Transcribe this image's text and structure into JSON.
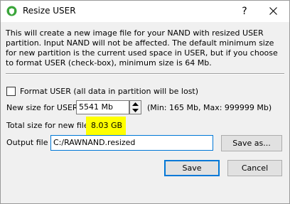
{
  "window": {
    "title": "Resize USER",
    "help_label": "?",
    "accent_color": "#0078d7"
  },
  "description": "This will create a new image file for your NAND with resized USER partition. Input NAND will not be affected. The default minimum size for new partition is the current used space in USER, but if you choose to format USER (check-box), minimum size is 64 Mb.",
  "format_option": {
    "label": "Format USER (all data in partition will be lost)",
    "checked": false
  },
  "new_size": {
    "label": "New size for USER :",
    "value": "5541 Mb",
    "range_text": "(Min: 165 Mb, Max: 999999 Mb)"
  },
  "total_size": {
    "label": "Total size for new file :",
    "value": "8.03 GB",
    "highlight_color": "#ffff00"
  },
  "output_file": {
    "label": "Output file :",
    "value": "C:/RAWNAND.resized",
    "browse_button": "Save as..."
  },
  "actions": {
    "save": "Save",
    "cancel": "Cancel"
  }
}
